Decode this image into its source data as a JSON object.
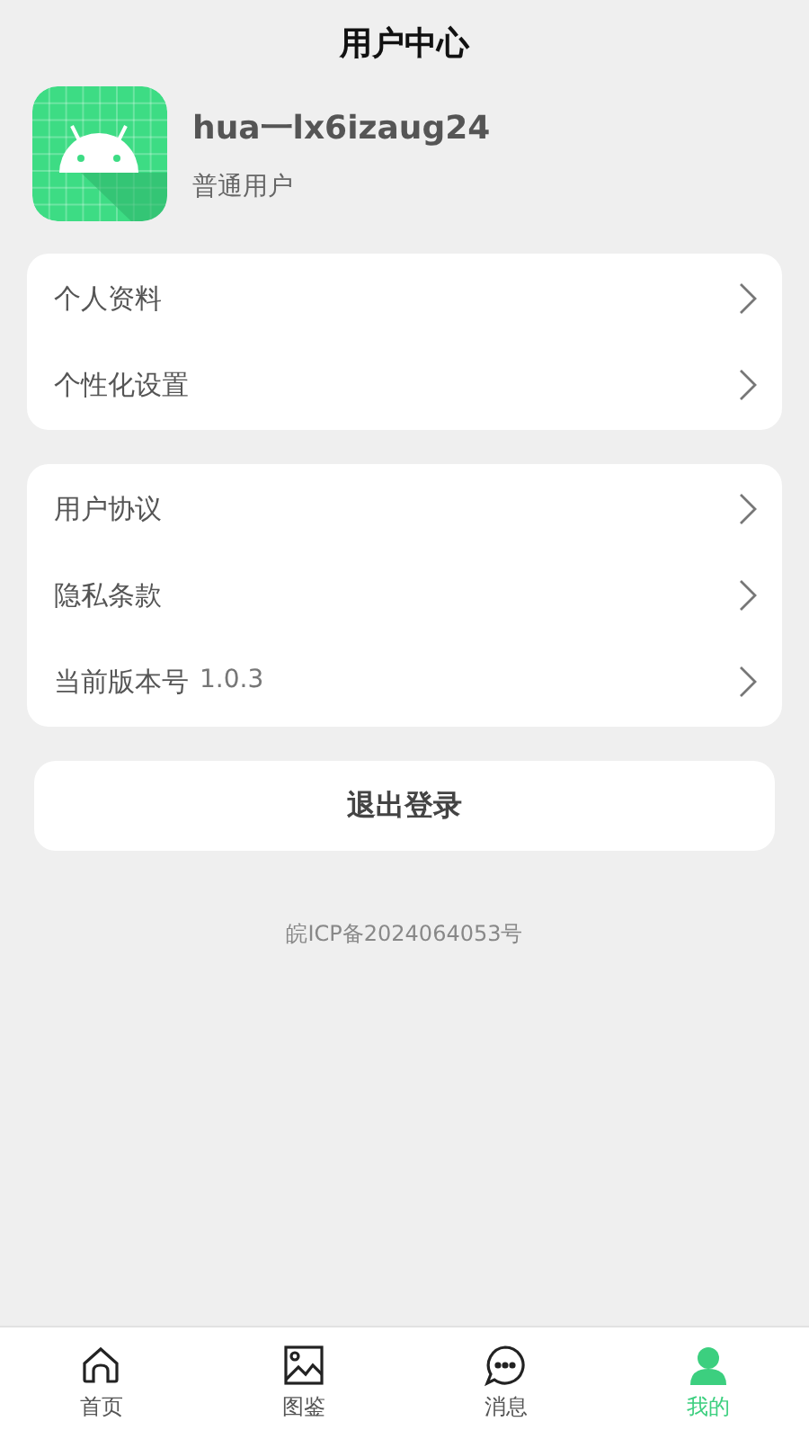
{
  "header": {
    "title": "用户中心"
  },
  "profile": {
    "username": "hua一lx6izaug24",
    "role": "普通用户"
  },
  "menu_groups": [
    {
      "items": [
        {
          "label": "个人资料"
        },
        {
          "label": "个性化设置"
        }
      ]
    },
    {
      "items": [
        {
          "label": "用户协议"
        },
        {
          "label": "隐私条款"
        },
        {
          "label": "当前版本号",
          "value": "1.0.3"
        }
      ]
    }
  ],
  "logout_button": "退出登录",
  "icp": "皖ICP备2024064053号",
  "tab_bar": [
    {
      "label": "首页",
      "selected": false
    },
    {
      "label": "图鉴",
      "selected": false
    },
    {
      "label": "消息",
      "selected": false
    },
    {
      "label": "我的",
      "selected": true
    }
  ]
}
